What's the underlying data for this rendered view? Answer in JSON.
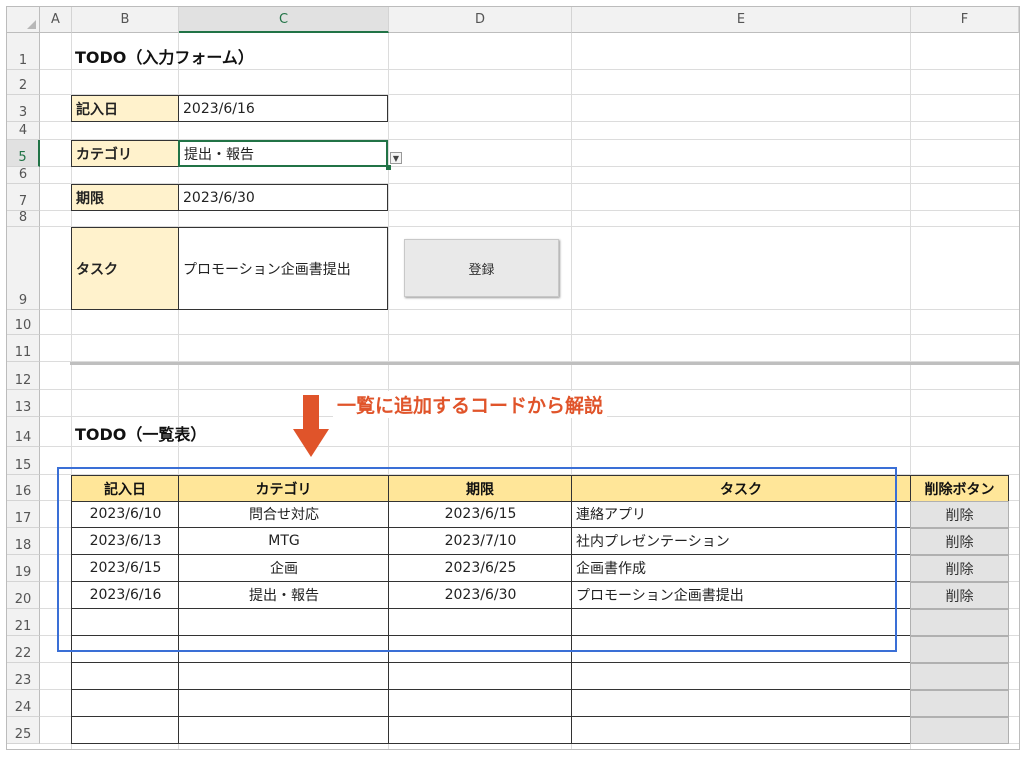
{
  "columns": [
    "A",
    "B",
    "C",
    "D",
    "E",
    "F"
  ],
  "rows": [
    "1",
    "2",
    "3",
    "4",
    "5",
    "6",
    "7",
    "8",
    "9",
    "10",
    "11",
    "12",
    "13",
    "14",
    "15",
    "16",
    "17",
    "18",
    "19",
    "20",
    "21",
    "22",
    "23",
    "24",
    "25"
  ],
  "form": {
    "title": "TODO（入力フォーム）",
    "date_label": "記入日",
    "date_value": "2023/6/16",
    "category_label": "カテゴリ",
    "category_value": "提出・報告",
    "deadline_label": "期限",
    "deadline_value": "2023/6/30",
    "task_label": "タスク",
    "task_value": "プロモーション企画書提出",
    "register_button": "登録"
  },
  "annotation": "一覧に追加するコードから解説",
  "list": {
    "title": "TODO（一覧表）",
    "headers": [
      "記入日",
      "カテゴリ",
      "期限",
      "タスク",
      "削除ボタン"
    ],
    "rows": [
      {
        "date": "2023/6/10",
        "category": "問合せ対応",
        "deadline": "2023/6/15",
        "task": "連絡アプリ",
        "action": "削除"
      },
      {
        "date": "2023/6/13",
        "category": "MTG",
        "deadline": "2023/7/10",
        "task": "社内プレゼンテーション",
        "action": "削除"
      },
      {
        "date": "2023/6/15",
        "category": "企画",
        "deadline": "2023/6/25",
        "task": "企画書作成",
        "action": "削除"
      },
      {
        "date": "2023/6/16",
        "category": "提出・報告",
        "deadline": "2023/6/30",
        "task": "プロモーション企画書提出",
        "action": "削除"
      }
    ]
  },
  "colors": {
    "label_bg": "#fff2cc",
    "header_bg": "#ffe699",
    "annotation": "#e0542a",
    "highlight_box": "#3a6fd6",
    "selected_cell": "#217346"
  }
}
